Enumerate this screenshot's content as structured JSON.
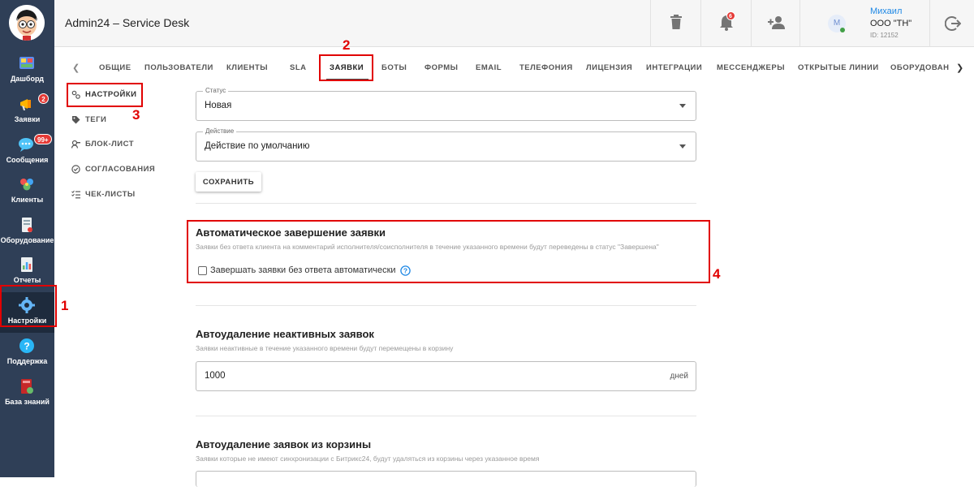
{
  "app": {
    "title": "Admin24 – Service Desk"
  },
  "sidebar": {
    "items": [
      {
        "label": "Дашборд",
        "icon": "dashboard-icon"
      },
      {
        "label": "Заявки",
        "icon": "megaphone-icon",
        "badge": "2"
      },
      {
        "label": "Сообщения",
        "icon": "chat-icon",
        "badge": "99+"
      },
      {
        "label": "Клиенты",
        "icon": "clients-icon"
      },
      {
        "label": "Оборудование",
        "icon": "equipment-icon"
      },
      {
        "label": "Отчеты",
        "icon": "reports-icon"
      },
      {
        "label": "Настройки",
        "icon": "gear-icon"
      },
      {
        "label": "Поддержка",
        "icon": "help-icon"
      },
      {
        "label": "База знаний",
        "icon": "book-icon"
      }
    ]
  },
  "header": {
    "notifications_badge": "6",
    "user": {
      "avatar_letter": "M",
      "name": "Михаил",
      "org": "ООО \"ТН\"",
      "id": "ID: 12152"
    }
  },
  "tabs": [
    "ОБЩИЕ",
    "ПОЛЬЗОВАТЕЛИ",
    "КЛИЕНТЫ",
    "SLA",
    "ЗАЯВКИ",
    "БОТЫ",
    "ФОРМЫ",
    "EMAIL",
    "ТЕЛЕФОНИЯ",
    "ЛИЦЕНЗИЯ",
    "ИНТЕГРАЦИИ",
    "МЕССЕНДЖЕРЫ",
    "ОТКРЫТЫЕ ЛИНИИ",
    "ОБОРУДОВАН"
  ],
  "active_tab": "ЗАЯВКИ",
  "submenu": [
    {
      "label": "НАСТРОЙКИ",
      "icon": "settings-icon"
    },
    {
      "label": "ТЕГИ",
      "icon": "tag-icon"
    },
    {
      "label": "БЛОК-ЛИСТ",
      "icon": "block-icon"
    },
    {
      "label": "СОГЛАСОВАНИЯ",
      "icon": "approval-icon"
    },
    {
      "label": "ЧЕК-ЛИСТЫ",
      "icon": "checklist-icon"
    }
  ],
  "form": {
    "status": {
      "label": "Статус",
      "value": "Новая"
    },
    "action": {
      "label": "Действие",
      "value": "Действие по умолчанию"
    },
    "save_label": "СОХРАНИТЬ"
  },
  "auto_close": {
    "title": "Автоматическое завершение заявки",
    "description": "Заявки без ответа клиента на комментарий исполнителя/соисполнителя в течение указанного времени будут переведены в статус \"Завершена\"",
    "checkbox_label": "Завершать заявки без ответа автоматически",
    "checked": false
  },
  "auto_delete_inactive": {
    "title": "Автоудаление неактивных заявок",
    "description": "Заявки неактивные в течение указанного времени будут перемещены в корзину",
    "value": "1000",
    "unit": "дней"
  },
  "auto_delete_trash": {
    "title": "Автоудаление заявок из корзины",
    "description": "Заявки которые не имеют синхронизации с Битрикс24, будут удаляться из корзины через указанное время"
  },
  "annotations": [
    "1",
    "2",
    "3",
    "4"
  ],
  "colors": {
    "sidebar": "#2f3f57",
    "annotation": "#e10000",
    "accent": "#1e88e5"
  }
}
